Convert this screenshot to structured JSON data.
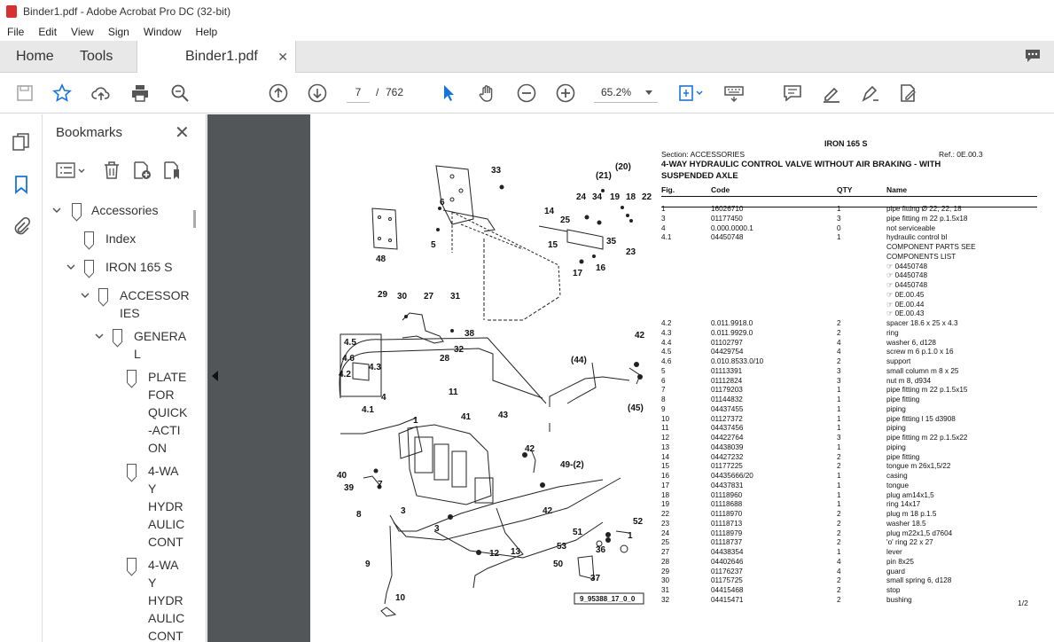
{
  "window": {
    "title": "Binder1.pdf - Adobe Acrobat Pro DC (32-bit)"
  },
  "menu": [
    "File",
    "Edit",
    "View",
    "Sign",
    "Window",
    "Help"
  ],
  "tabs": {
    "home": "Home",
    "tools": "Tools",
    "document": "Binder1.pdf"
  },
  "toolbar": {
    "page_current": "7",
    "page_separator": "/",
    "page_total": "762",
    "zoom": "65.2%"
  },
  "bookmarks": {
    "title": "Bookmarks",
    "items": [
      {
        "label": "Accessories"
      },
      {
        "label": "Index"
      },
      {
        "label": "IRON 165 S"
      },
      {
        "label": "ACCESSOR\nIES"
      },
      {
        "label": "GENERA\nL"
      },
      {
        "label": "PLATE\nFOR\nQUICK\n-ACTI\nON"
      },
      {
        "label": "4-WA\nY\nHYDR\nAULIC\nCONT"
      },
      {
        "label": "4-WA\nY\nHYDR\nAULIC\nCONT"
      }
    ]
  },
  "document": {
    "model": "IRON 165 S",
    "section": "Section: ACCESSORIES",
    "ref": "Ref.: 0E.00.3",
    "heading_line1": "4-WAY HYDRAULIC CONTROL VALVE WITHOUT AIR BRAKING - WITH",
    "heading_line2": "SUSPENDED AXLE",
    "columns": {
      "fig": "Fig.",
      "code": "Code",
      "qty": "QTY",
      "name": "Name"
    },
    "rows": [
      {
        "fig": "1",
        "code": "16026710",
        "qty": "1",
        "name": "pipe fitting Ø 22, 22, 18"
      },
      {
        "fig": "3",
        "code": "01177450",
        "qty": "3",
        "name": "pipe fitting m 22 p.1.5x18"
      },
      {
        "fig": "4",
        "code": "0.000.0000.1",
        "qty": "0",
        "name": "not serviceable"
      },
      {
        "fig": "4.1",
        "code": "04450748",
        "qty": "1",
        "name": "hydraulic control bl"
      },
      {
        "fig": "",
        "code": "",
        "qty": "",
        "name": "COMPONENT PARTS SEE"
      },
      {
        "fig": "",
        "code": "",
        "qty": "",
        "name": "COMPONENTS LIST"
      },
      {
        "fig": "",
        "code": "",
        "qty": "",
        "name": "☞ 04450748"
      },
      {
        "fig": "",
        "code": "",
        "qty": "",
        "name": "☞ 04450748"
      },
      {
        "fig": "",
        "code": "",
        "qty": "",
        "name": "☞ 04450748"
      },
      {
        "fig": "",
        "code": "",
        "qty": "",
        "name": "☞ 0E.00.45"
      },
      {
        "fig": "",
        "code": "",
        "qty": "",
        "name": "☞ 0E.00.44"
      },
      {
        "fig": "",
        "code": "",
        "qty": "",
        "name": "☞ 0E.00.43"
      },
      {
        "fig": "4.2",
        "code": "0.011.9918.0",
        "qty": "2",
        "name": "spacer 18.6 x 25 x 4.3"
      },
      {
        "fig": "4.3",
        "code": "0.011.9929.0",
        "qty": "2",
        "name": "ring"
      },
      {
        "fig": "4.4",
        "code": "01102797",
        "qty": "4",
        "name": "washer 6, d128"
      },
      {
        "fig": "4.5",
        "code": "04429754",
        "qty": "4",
        "name": "screw m 6 p.1.0 x 16"
      },
      {
        "fig": "4.6",
        "code": "0.010.8533.0/10",
        "qty": "2",
        "name": "support"
      },
      {
        "fig": "5",
        "code": "01113391",
        "qty": "3",
        "name": "small column m 8 x 25"
      },
      {
        "fig": "6",
        "code": "01112824",
        "qty": "3",
        "name": "nut m 8, d934"
      },
      {
        "fig": "7",
        "code": "01179203",
        "qty": "1",
        "name": "pipe fitting m 22 p.1.5x15"
      },
      {
        "fig": "8",
        "code": "01144832",
        "qty": "1",
        "name": "pipe fitting"
      },
      {
        "fig": "9",
        "code": "04437455",
        "qty": "1",
        "name": "piping"
      },
      {
        "fig": "10",
        "code": "01127372",
        "qty": "1",
        "name": "pipe fitting l 15 d3908"
      },
      {
        "fig": "11",
        "code": "04437456",
        "qty": "1",
        "name": "piping"
      },
      {
        "fig": "12",
        "code": "04422764",
        "qty": "3",
        "name": "pipe fitting m 22 p.1.5x22"
      },
      {
        "fig": "13",
        "code": "04438039",
        "qty": "1",
        "name": "piping"
      },
      {
        "fig": "14",
        "code": "04427232",
        "qty": "2",
        "name": "pipe fitting"
      },
      {
        "fig": "15",
        "code": "01177225",
        "qty": "2",
        "name": "tongue m 26x1,5/22"
      },
      {
        "fig": "16",
        "code": "04435666/20",
        "qty": "1",
        "name": "casing"
      },
      {
        "fig": "17",
        "code": "04437831",
        "qty": "1",
        "name": "tongue"
      },
      {
        "fig": "18",
        "code": "01118960",
        "qty": "1",
        "name": "plug am14x1,5"
      },
      {
        "fig": "19",
        "code": "01118688",
        "qty": "1",
        "name": "ring 14x17"
      },
      {
        "fig": "22",
        "code": "01118970",
        "qty": "2",
        "name": "plug m 18 p.1.5"
      },
      {
        "fig": "23",
        "code": "01118713",
        "qty": "2",
        "name": "washer 18.5"
      },
      {
        "fig": "24",
        "code": "01118979",
        "qty": "2",
        "name": "plug m22x1,5 d7604"
      },
      {
        "fig": "25",
        "code": "01118737",
        "qty": "2",
        "name": "'o' ring 22 x 27"
      },
      {
        "fig": "27",
        "code": "04438354",
        "qty": "1",
        "name": "lever"
      },
      {
        "fig": "28",
        "code": "04402646",
        "qty": "4",
        "name": "pin 8x25"
      },
      {
        "fig": "29",
        "code": "01176237",
        "qty": "4",
        "name": "guard"
      },
      {
        "fig": "30",
        "code": "01175725",
        "qty": "2",
        "name": "small spring 6, d128"
      },
      {
        "fig": "31",
        "code": "04415468",
        "qty": "2",
        "name": "stop"
      },
      {
        "fig": "32",
        "code": "04415471",
        "qty": "2",
        "name": "bushing"
      }
    ],
    "page_of": "1/2",
    "diagram_code": "9_95388_17_0_0",
    "callouts": [
      "33",
      "(21)",
      "(20)",
      "6",
      "24",
      "34",
      "19",
      "18",
      "22",
      "14",
      "25",
      "5",
      "15",
      "35",
      "16",
      "23",
      "17",
      "48",
      "29",
      "30",
      "27",
      "31",
      "38",
      "32",
      "28",
      "42",
      "4.5",
      "4.6",
      "4.3",
      "4.2",
      "4",
      "4.1",
      "11",
      "(44)",
      "(45)",
      "41",
      "43",
      "1",
      "40",
      "39",
      "7",
      "3",
      "8",
      "3",
      "42",
      "49-(2)",
      "42",
      "52",
      "51",
      "53",
      "36",
      "1",
      "50",
      "37",
      "9",
      "12",
      "13",
      "10"
    ]
  },
  "colors": {
    "accent": "#1473e6",
    "acrobat_red": "#d9302c",
    "doc_bg": "#525659"
  }
}
